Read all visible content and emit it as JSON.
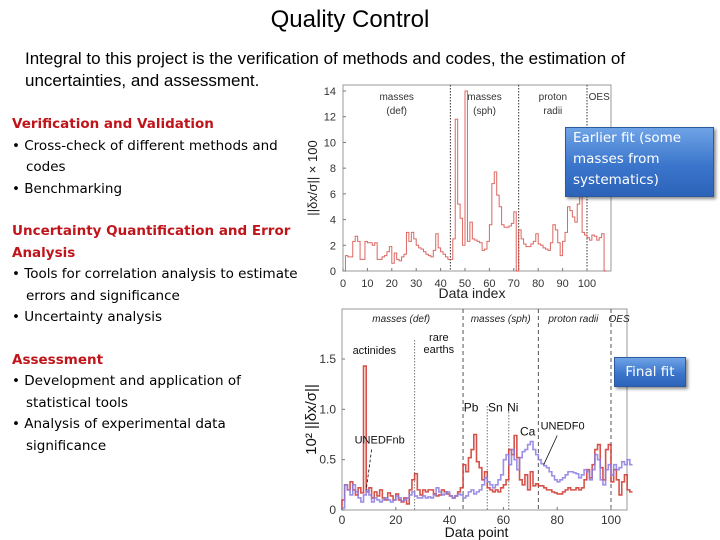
{
  "title": "Quality Control",
  "intro": "Integral to this project is the verification of methods  and codes, the estimation of uncertainties, and assessment.",
  "sections": [
    {
      "heading": "Verification and Validation",
      "bullets": [
        "•  Cross-check of different methods and codes",
        "• Benchmarking"
      ]
    },
    {
      "heading": "Uncertainty Quantification and Error Analysis",
      "bullets": [
        "•  Tools for correlation analysis to estimate errors and significance",
        "•  Uncertainty analysis"
      ]
    },
    {
      "heading": "Assessment",
      "bullets": [
        "• Development and application of statistical tools",
        "•  Analysis of experimental data significance"
      ]
    }
  ],
  "callouts": {
    "earlier": "Earlier fit (some masses from systematics)",
    "final": "Final fit"
  },
  "colors": {
    "heading": "#c0141b",
    "series_red": "#d0342c",
    "series_blue": "#8a7de0",
    "callout": "#3b76cc"
  },
  "chart_data": [
    {
      "type": "line",
      "style": "step",
      "title": "",
      "xlabel": "Data index",
      "ylabel": "||δx/σ|| × 100",
      "xlim": [
        0,
        110
      ],
      "ylim": [
        0,
        14.5
      ],
      "xticks": [
        0,
        10,
        20,
        30,
        40,
        50,
        60,
        70,
        80,
        90,
        100
      ],
      "yticks": [
        0,
        2,
        4,
        6,
        8,
        10,
        12,
        14
      ],
      "separators": [
        44,
        72,
        100
      ],
      "region_labels": [
        {
          "text": "masses",
          "text2": "(def)",
          "x": 22
        },
        {
          "text": "masses",
          "text2": "(sph)",
          "x": 58
        },
        {
          "text": "proton",
          "text2": "radii",
          "x": 86
        },
        {
          "text": "OES",
          "text2": "",
          "x": 105
        }
      ],
      "grid": false,
      "series": [
        {
          "name": "earlier fit",
          "color": "#d0342c",
          "values": [
            0,
            1.2,
            1.1,
            1.1,
            2.3,
            2.7,
            2.3,
            0.9,
            0.9,
            2.3,
            2.2,
            2.2,
            2.0,
            2.2,
            0.9,
            0.9,
            1.1,
            1.2,
            1.5,
            1.9,
            0.6,
            1.4,
            0.9,
            0.8,
            1.1,
            1.3,
            3.0,
            2.3,
            3.0,
            2.5,
            2.0,
            1.8,
            1.7,
            1.5,
            1.3,
            1.2,
            1.1,
            1.6,
            2.9,
            1.8,
            1.5,
            1.3,
            1.1,
            0.9,
            0.9,
            2.5,
            11.8,
            5.2,
            4.1,
            2.0,
            14.0,
            2.3,
            3.8,
            2.5,
            2.4,
            2.3,
            2.2,
            1.6,
            1.7,
            2.3,
            3.6,
            6.8,
            7.7,
            5.9,
            5.0,
            3.6,
            3.4,
            3.4,
            3.5,
            3.7,
            4.6,
            0,
            3.2,
            2.5,
            2.1,
            1.9,
            1.9,
            2.1,
            2.3,
            2.9,
            2.1,
            2.0,
            1.8,
            1.7,
            1.6,
            2.2,
            3.6,
            3.2,
            2.2,
            1.2,
            2.3,
            3.0,
            5.0,
            4.7,
            4.2,
            3.8,
            5.2,
            6.8,
            3.0,
            2.8,
            2.6,
            2.4,
            2.8,
            2.7,
            2.4,
            2.6,
            2.9,
            0
          ]
        }
      ]
    },
    {
      "type": "line",
      "style": "step",
      "title": "",
      "xlabel": "Data point",
      "ylabel": "10² ||δx/σ||",
      "xlim": [
        0,
        106
      ],
      "ylim": [
        0,
        1.95
      ],
      "xticks": [
        0,
        20,
        40,
        60,
        80,
        100
      ],
      "yticks": [
        0,
        0.5,
        1.0,
        1.5
      ],
      "ytick_labels": [
        "0",
        "0.5",
        "1.0",
        "1.5"
      ],
      "separators_major": [
        45,
        73,
        100
      ],
      "separators_minor": [
        27,
        54,
        62
      ],
      "region_labels": [
        {
          "text": "masses (def)",
          "x": 22
        },
        {
          "text": "masses (sph)",
          "x": 59
        },
        {
          "text": "proton radii",
          "x": 86
        },
        {
          "text": "OES",
          "x": 103
        }
      ],
      "annotations": [
        {
          "text": "actinides",
          "x": 12,
          "y": 1.55
        },
        {
          "text": "rare",
          "x": 36,
          "y": 1.68
        },
        {
          "text": "earths",
          "x": 36,
          "y": 1.56
        },
        {
          "text": "Pb",
          "x": 48,
          "y": 0.98
        },
        {
          "text": "Sn",
          "x": 57,
          "y": 0.98
        },
        {
          "text": "Ni",
          "x": 63.5,
          "y": 0.98
        },
        {
          "text": "Ca",
          "x": 69,
          "y": 0.74
        },
        {
          "text": "UNEDFnb",
          "x": 14,
          "y": 0.66
        },
        {
          "text": "UNEDF0",
          "x": 82,
          "y": 0.8
        }
      ],
      "grid": false,
      "series": [
        {
          "name": "UNEDFnb",
          "color": "#d0342c",
          "values": [
            0.1,
            0.25,
            0.2,
            0.28,
            0.2,
            0.15,
            0.22,
            0.17,
            1.43,
            0.18,
            0.22,
            0.12,
            0.18,
            0.14,
            0.2,
            0.12,
            0.1,
            0.17,
            0.14,
            0.1,
            0.16,
            0.1,
            0.08,
            0.12,
            0.06,
            0.2,
            0.3,
            0.36,
            0.2,
            0.15,
            0.2,
            0.18,
            0.2,
            0.2,
            0.16,
            0.14,
            0.15,
            0.2,
            0.18,
            0.16,
            0.14,
            0.12,
            0.14,
            0.18,
            0.22,
            0.45,
            0.38,
            0.52,
            0.6,
            0.75,
            0.48,
            0.42,
            0.3,
            0.38,
            0.22,
            0.2,
            0.18,
            0.2,
            0.18,
            0.22,
            0.25,
            0.3,
            0.6,
            0.55,
            0.74,
            0.52,
            0.3,
            0.25,
            0.35,
            0.2,
            0.38,
            0.24,
            0.26,
            0.24,
            0.24,
            0.22,
            0.2,
            0.2,
            0.18,
            0.17,
            0.16,
            0.16,
            0.18,
            0.2,
            0.22,
            0.2,
            0.2,
            0.22,
            0.2,
            0.22,
            0.3,
            0.4,
            0.32,
            0.45,
            0.6,
            0.65,
            0.42,
            0.3,
            0.6,
            0.65,
            0.28,
            0.4,
            0.3,
            0.15,
            0.28,
            0.35,
            0.2,
            0.18
          ]
        },
        {
          "name": "UNEDF0",
          "color": "#8a7de0",
          "values": [
            0.02,
            0.25,
            0.2,
            0.15,
            0.25,
            0.18,
            0.12,
            0.08,
            0.15,
            0.2,
            0.15,
            0.08,
            0.12,
            0.1,
            0.08,
            0.1,
            0.12,
            0.1,
            0.08,
            0.1,
            0.14,
            0.12,
            0.09,
            0.1,
            0.12,
            0.15,
            0.18,
            0.14,
            0.12,
            0.12,
            0.14,
            0.12,
            0.13,
            0.12,
            0.15,
            0.22,
            0.18,
            0.15,
            0.16,
            0.18,
            0.14,
            0.12,
            0.14,
            0.16,
            0.15,
            0.12,
            0.14,
            0.18,
            0.2,
            0.16,
            0.18,
            0.2,
            0.25,
            0.32,
            0.28,
            0.25,
            0.22,
            0.25,
            0.3,
            0.35,
            0.5,
            0.55,
            0.45,
            0.6,
            0.5,
            0.4,
            0.52,
            0.58,
            0.6,
            0.65,
            0.68,
            0.6,
            0.55,
            0.5,
            0.46,
            0.44,
            0.42,
            0.38,
            0.34,
            0.3,
            0.28,
            0.3,
            0.32,
            0.35,
            0.38,
            0.38,
            0.37,
            0.36,
            0.32,
            0.35,
            0.4,
            0.38,
            0.3,
            0.4,
            0.55,
            0.5,
            0.3,
            0.25,
            0.4,
            0.45,
            0.35,
            0.45,
            0.4,
            0.42,
            0.48,
            0.45,
            0.5,
            0.45
          ]
        }
      ]
    }
  ]
}
